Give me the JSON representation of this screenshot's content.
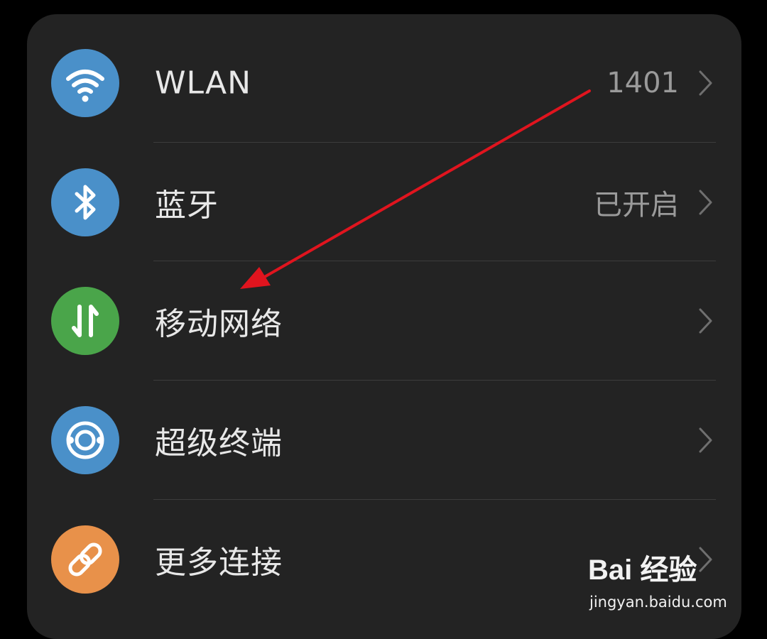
{
  "settings_list": {
    "items": [
      {
        "label": "WLAN",
        "value": "1401",
        "icon": "wifi-icon",
        "icon_color": "#4a90c9"
      },
      {
        "label": "蓝牙",
        "value": "已开启",
        "icon": "bluetooth-icon",
        "icon_color": "#4a90c9"
      },
      {
        "label": "移动网络",
        "value": "",
        "icon": "mobile-data-icon",
        "icon_color": "#4aa54a"
      },
      {
        "label": "超级终端",
        "value": "",
        "icon": "super-device-icon",
        "icon_color": "#4a90c9"
      },
      {
        "label": "更多连接",
        "value": "",
        "icon": "link-icon",
        "icon_color": "#e8914a"
      }
    ]
  },
  "annotation": {
    "arrow_color": "#e0141e"
  },
  "watermark": {
    "brand": "Bai 经验",
    "url": "jingyan.baidu.com"
  }
}
